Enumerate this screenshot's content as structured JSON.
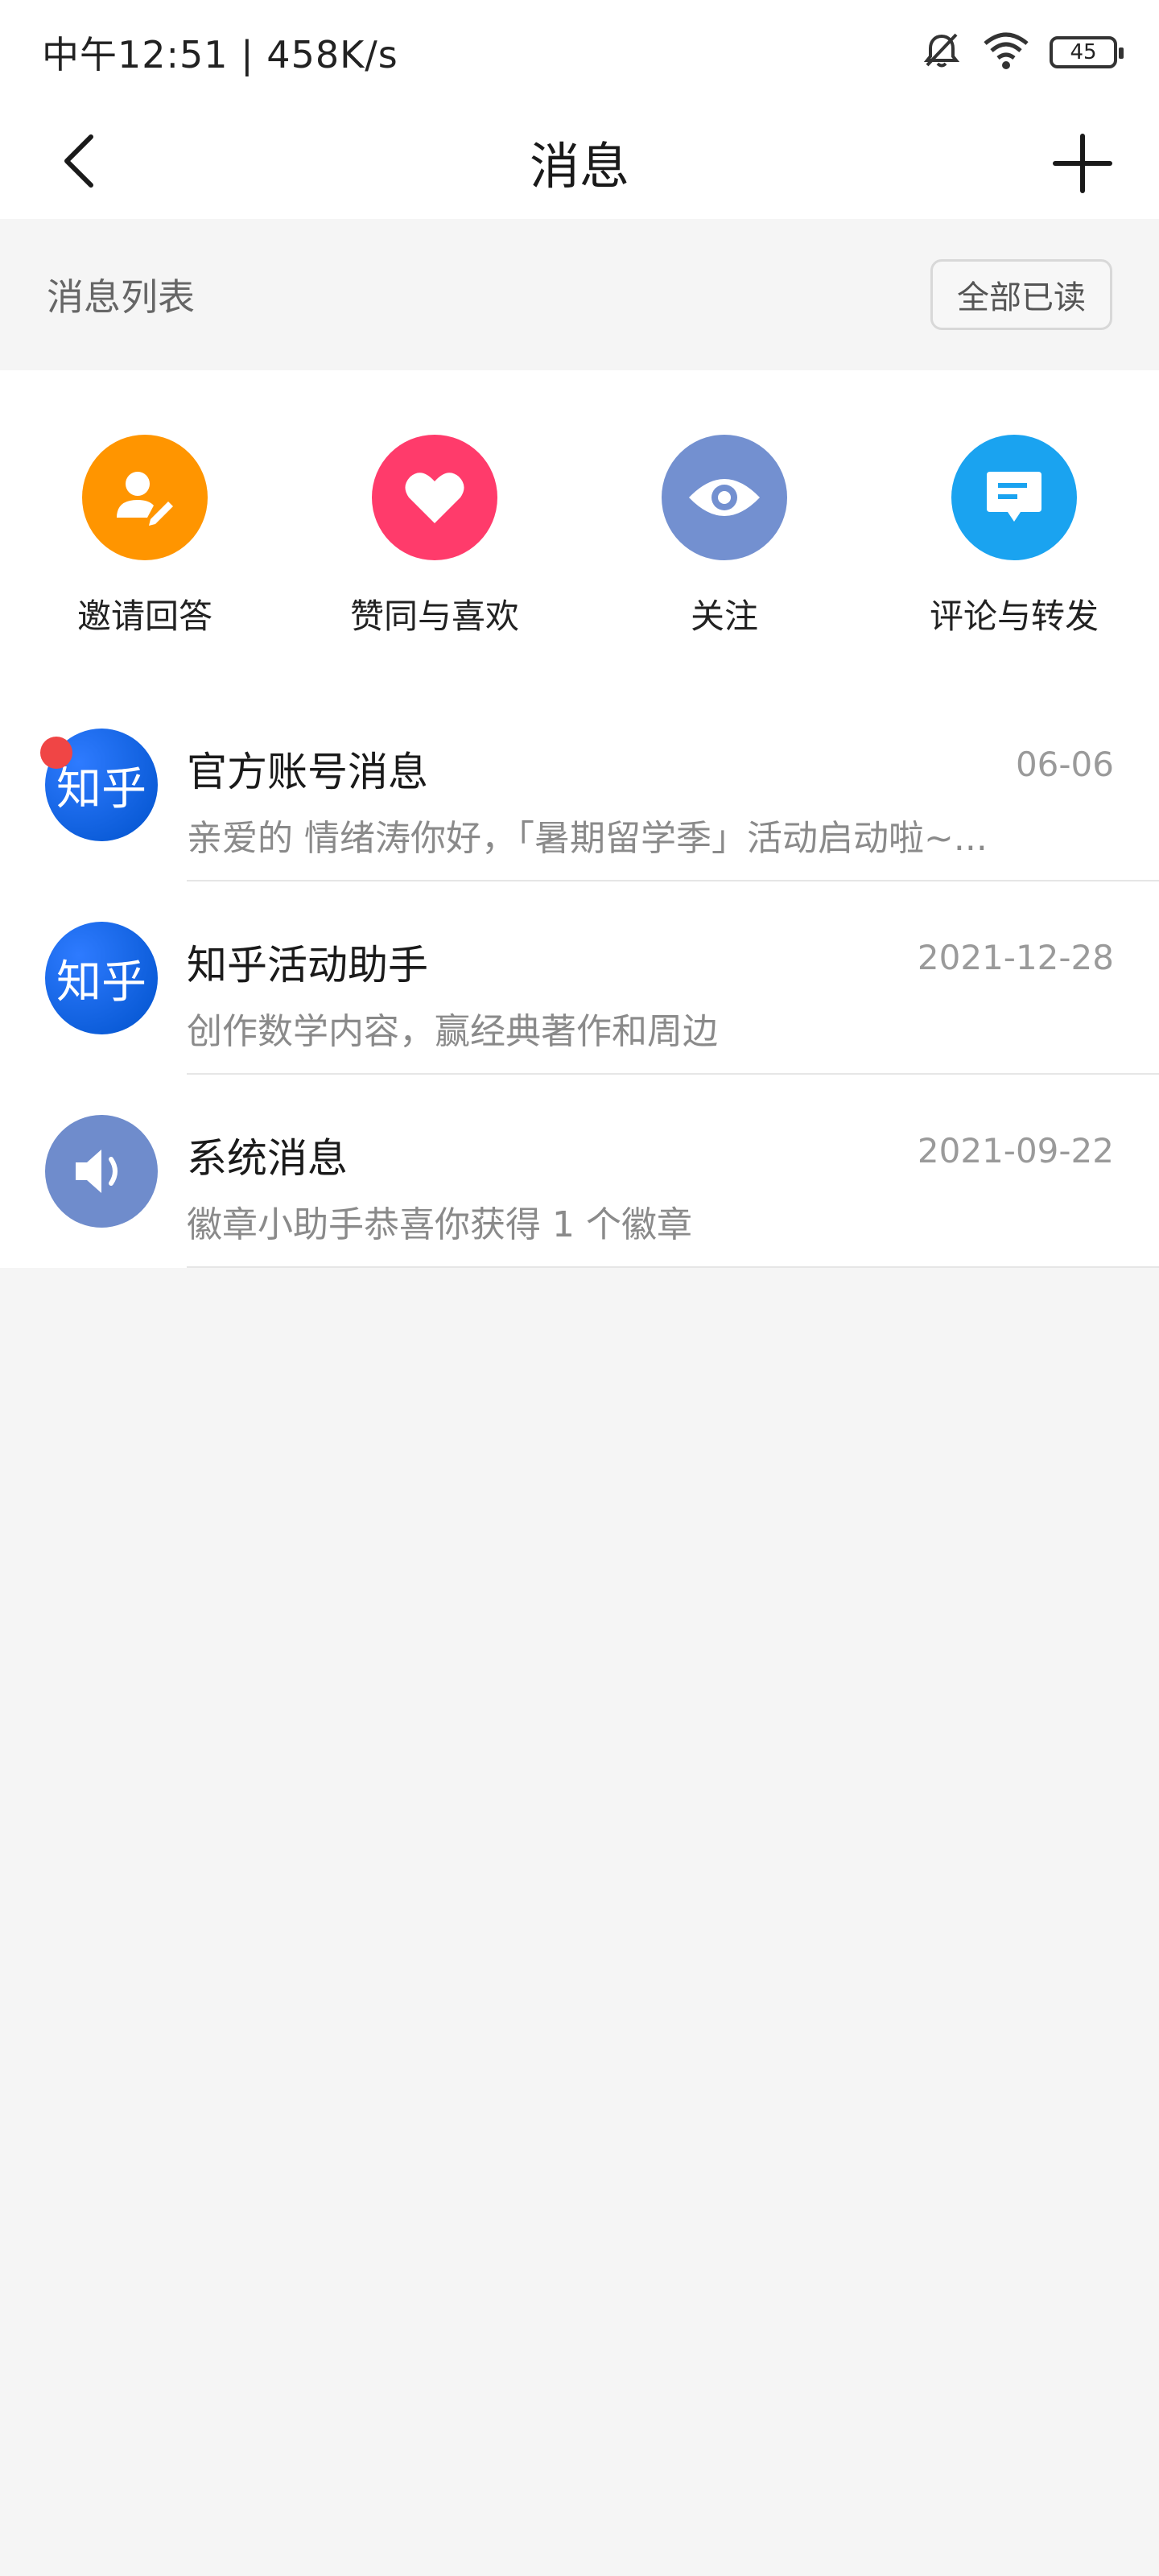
{
  "status_bar": {
    "time_speed": "中午12:51 | 458K/s",
    "battery": "45",
    "icons": [
      "bell-off-icon",
      "wifi-icon",
      "battery-icon"
    ]
  },
  "nav": {
    "title": "消息",
    "back_icon": "back-arrow-icon",
    "add_icon": "plus-icon"
  },
  "section": {
    "title": "消息列表",
    "read_all_button": "全部已读"
  },
  "categories": [
    {
      "label": "邀请回答",
      "icon": "invite-answer-icon",
      "color": "#ff9500"
    },
    {
      "label": "赞同与喜欢",
      "icon": "heart-icon",
      "color": "#ff3b6b"
    },
    {
      "label": "关注",
      "icon": "eye-icon",
      "color": "#7390d0"
    },
    {
      "label": "评论与转发",
      "icon": "comment-icon",
      "color": "#1aa3f0"
    }
  ],
  "messages": [
    {
      "title": "官方账号消息",
      "date": "06-06",
      "preview": "亲爱的 情绪涛你好，「暑期留学季」活动启动啦~...",
      "avatar_text": "知乎",
      "unread": true
    },
    {
      "title": "知乎活动助手",
      "date": "2021-12-28",
      "preview": "创作数学内容，赢经典著作和周边",
      "avatar_text": "知乎",
      "unread": false
    },
    {
      "title": "系统消息",
      "date": "2021-09-22",
      "preview": "徽章小助手恭喜你获得 1 个徽章",
      "avatar_text": "",
      "unread": false
    }
  ],
  "colors": {
    "background": "#f5f5f5",
    "card": "#ffffff",
    "unread_dot": "#f04545",
    "zhihu_blue": "#0066ff"
  }
}
